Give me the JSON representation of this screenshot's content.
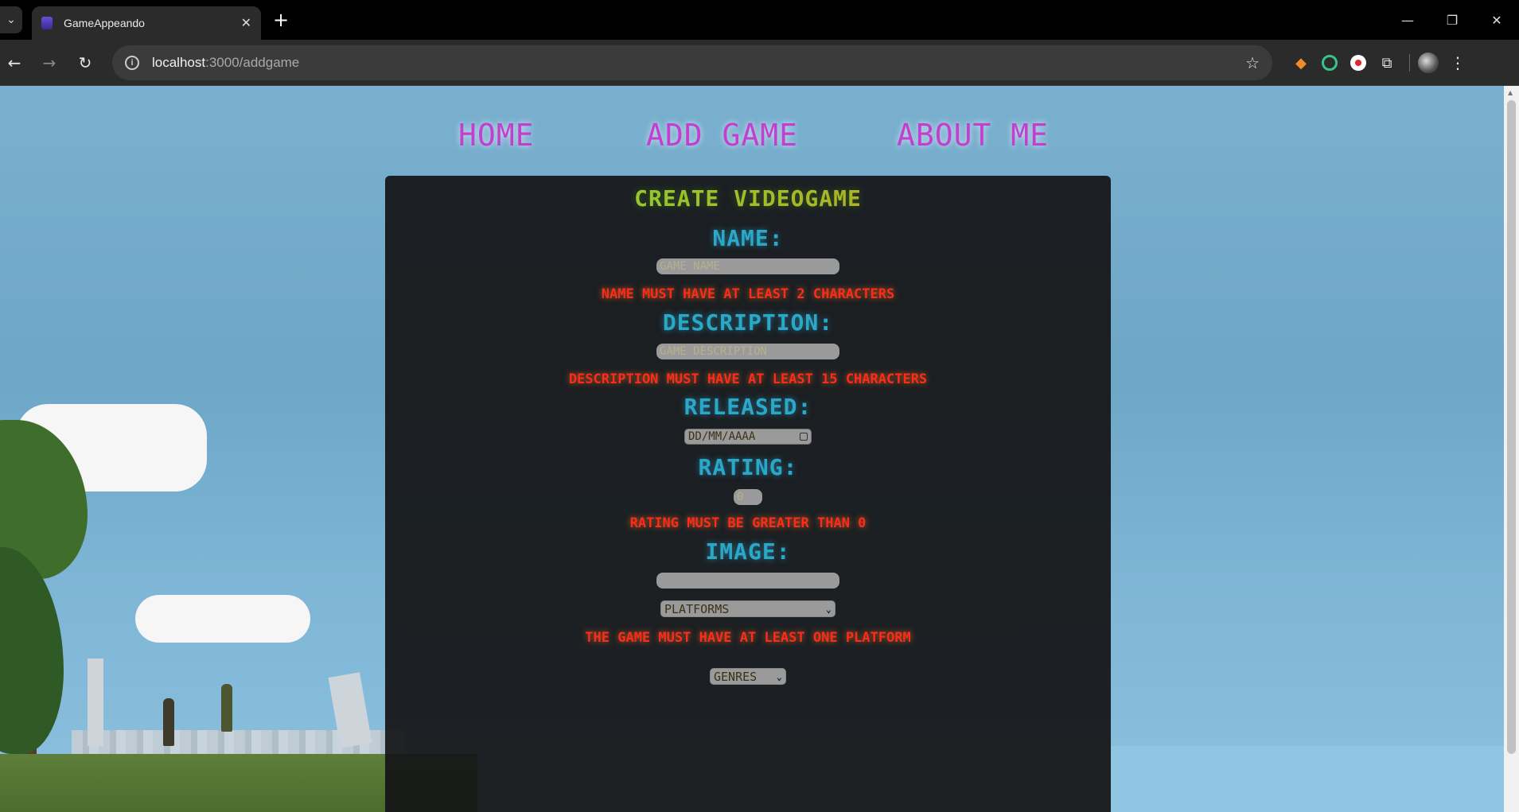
{
  "browser": {
    "tab_title": "GameAppeando",
    "tab_close": "✕",
    "new_tab": "+",
    "url_host": "localhost",
    "url_path": ":3000/addgame"
  },
  "nav": {
    "home": "HOME",
    "add_game": "ADD GAME",
    "about_me": "ABOUT ME"
  },
  "form": {
    "title": "CREATE VIDEOGAME",
    "name_label": "NAME:",
    "name_placeholder": "GAME NAME",
    "name_error": "NAME MUST HAVE AT LEAST 2 CHARACTERS",
    "description_label": "DESCRIPTION:",
    "description_placeholder": "GAME DESCRIPTION",
    "description_error": "DESCRIPTION MUST HAVE AT LEAST 15 CHARACTERS",
    "released_label": "RELEASED:",
    "released_placeholder": "DD/MM/AAAA",
    "rating_label": "RATING:",
    "rating_placeholder": "0",
    "rating_error": "RATING MUST BE GREATER THAN 0",
    "image_label": "IMAGE:",
    "image_placeholder": "",
    "platforms_select": "PLATFORMS",
    "platforms_error": "THE GAME MUST HAVE AT LEAST ONE PLATFORM",
    "genres_select": "GENRES"
  },
  "colors": {
    "nav_link": "#c23fd0",
    "label": "#2aa8c9",
    "error": "#ff2a1a",
    "title_start": "#7be03a",
    "title_end": "#d69a18"
  }
}
